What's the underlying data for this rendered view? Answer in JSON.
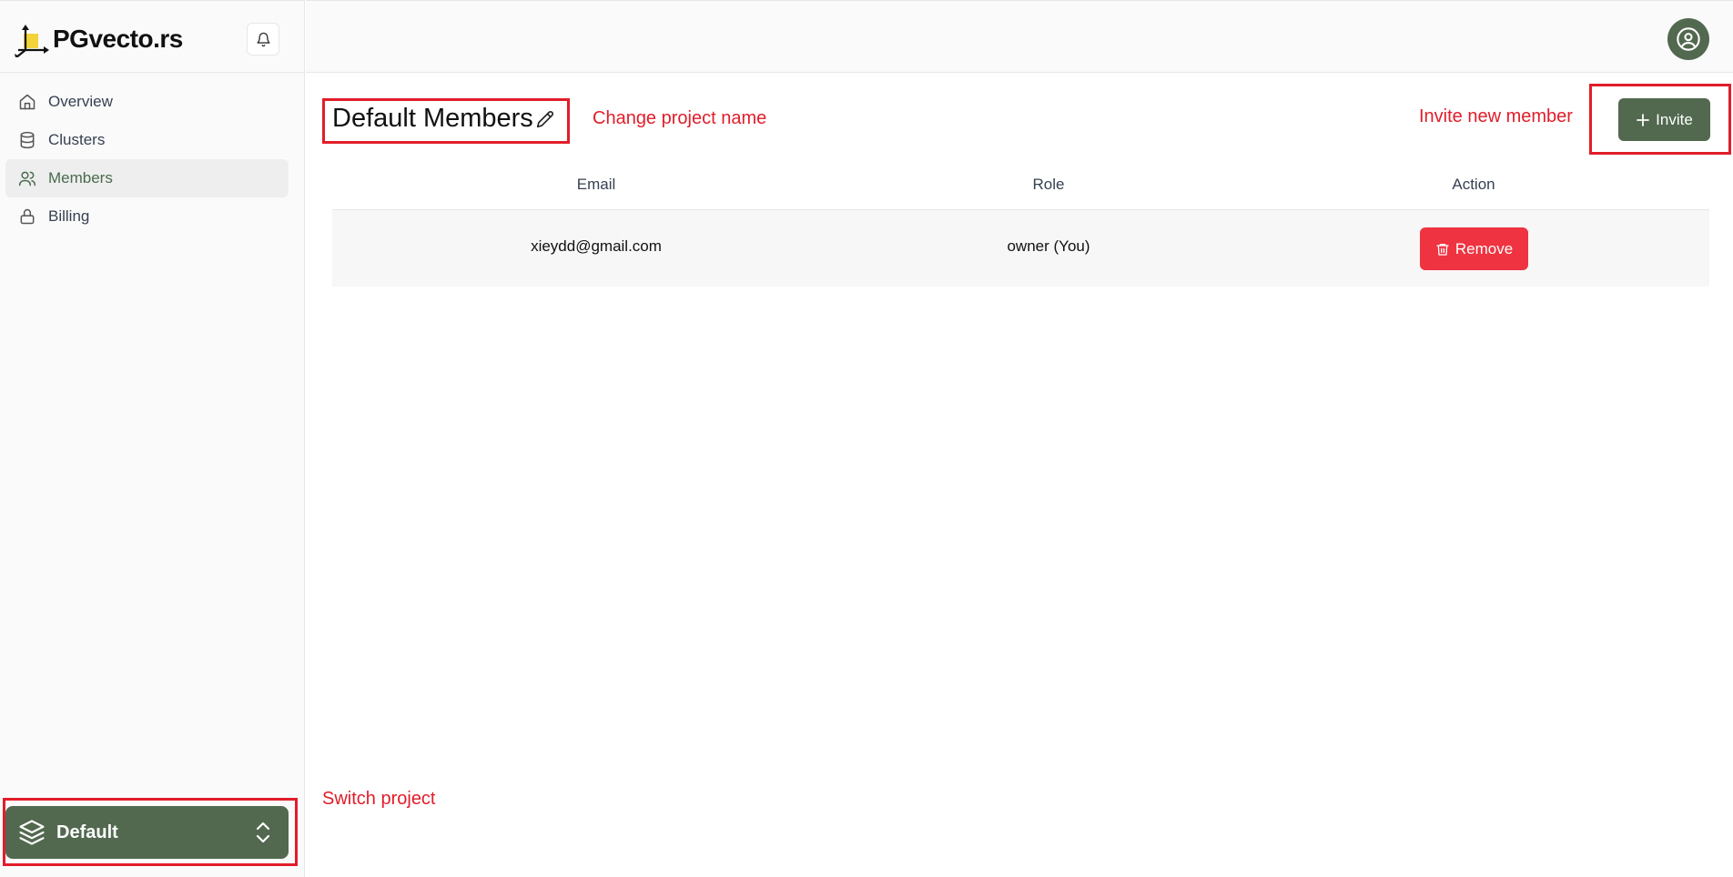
{
  "app": {
    "logo_text": "PGvecto.rs"
  },
  "sidebar": {
    "items": [
      {
        "label": "Overview",
        "icon": "home-icon"
      },
      {
        "label": "Clusters",
        "icon": "database-icon"
      },
      {
        "label": "Members",
        "icon": "users-icon",
        "active": true
      },
      {
        "label": "Billing",
        "icon": "lock-icon"
      }
    ],
    "project_switcher": {
      "name": "Default",
      "icon": "layers-icon"
    }
  },
  "main": {
    "title": "Default Members",
    "invite_label": "Invite",
    "table": {
      "columns": [
        "Email",
        "Role",
        "Action"
      ],
      "rows": [
        {
          "email": "xieydd@gmail.com",
          "role": "owner (You)",
          "action_label": "Remove"
        }
      ]
    }
  },
  "annotations": {
    "change_project_name": "Change project name",
    "invite_new_member": "Invite new member",
    "switch_project": "Switch project"
  },
  "colors": {
    "accent": "#52694f",
    "danger": "#ef3340",
    "annotation": "#e11d2a"
  }
}
